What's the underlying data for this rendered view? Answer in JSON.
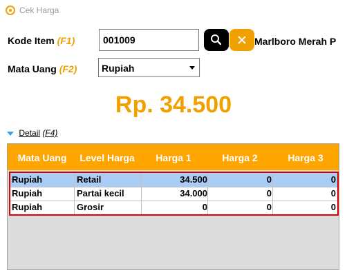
{
  "window": {
    "title": "Cek Harga"
  },
  "form": {
    "kode_label": "Kode Item",
    "kode_hotkey": "(F1)",
    "kode_value": "001009",
    "item_name": "Marlboro Merah P",
    "mata_label": "Mata Uang",
    "mata_hotkey": "(F2)",
    "mata_value": "Rupiah"
  },
  "price": {
    "display": "Rp. 34.500"
  },
  "detail": {
    "label": "Detail",
    "hotkey": "(F4)"
  },
  "table": {
    "headers": [
      "Mata Uang",
      "Level Harga",
      "Harga 1",
      "Harga 2",
      "Harga 3"
    ],
    "rows": [
      [
        "Rupiah",
        "Retail",
        "34.500",
        "0",
        "0"
      ],
      [
        "Rupiah",
        "Partai kecil",
        "34.000",
        "0",
        "0"
      ],
      [
        "Rupiah",
        "Grosir",
        "0",
        "0",
        "0"
      ]
    ]
  },
  "colors": {
    "accent": "#f0a000",
    "header_bg": "#ffa500",
    "selected_row": "#a9cdf5",
    "highlight_border": "#e00000"
  },
  "icons": {
    "app": "price-tag-icon",
    "search": "search-icon",
    "clear": "close-icon",
    "detail": "triangle-down-icon",
    "dropdown": "chevron-down-icon"
  }
}
